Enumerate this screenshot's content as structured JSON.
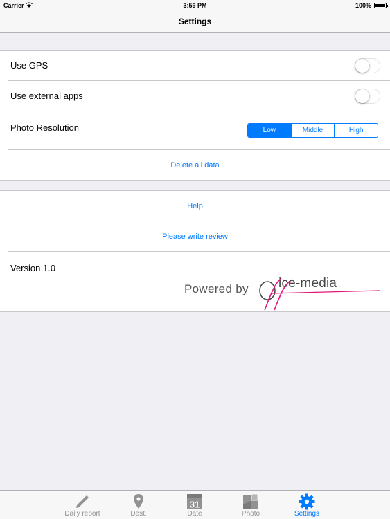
{
  "status_bar": {
    "carrier": "Carrier",
    "time": "3:59 PM",
    "battery": "100%",
    "battery_level": 1.0
  },
  "nav": {
    "title": "Settings"
  },
  "settings": {
    "use_gps": {
      "label": "Use GPS",
      "on": false
    },
    "use_external_apps": {
      "label": "Use external apps",
      "on": false
    },
    "photo_resolution": {
      "label": "Photo Resolution",
      "options": [
        "Low",
        "Middle",
        "High"
      ],
      "selected": "Low"
    },
    "delete_all": "Delete all data"
  },
  "info": {
    "help": "Help",
    "review": "Please write review",
    "version": "Version 1.0",
    "powered_by": "Powered by",
    "brand": "ice-media"
  },
  "tabs": [
    {
      "label": "Daily report",
      "icon": "pencil-icon",
      "active": false
    },
    {
      "label": "Dest.",
      "icon": "map-pin-icon",
      "active": false
    },
    {
      "label": "Date",
      "icon": "calendar-icon",
      "day": "31",
      "active": false
    },
    {
      "label": "Photo",
      "icon": "photo-icon",
      "active": false
    },
    {
      "label": "Settings",
      "icon": "gear-icon",
      "active": true
    }
  ],
  "colors": {
    "accent": "#007aff",
    "background": "#efeff4",
    "separator": "#c8c7cc",
    "tab_inactive": "#929292",
    "logo_pink": "#e2167e"
  }
}
